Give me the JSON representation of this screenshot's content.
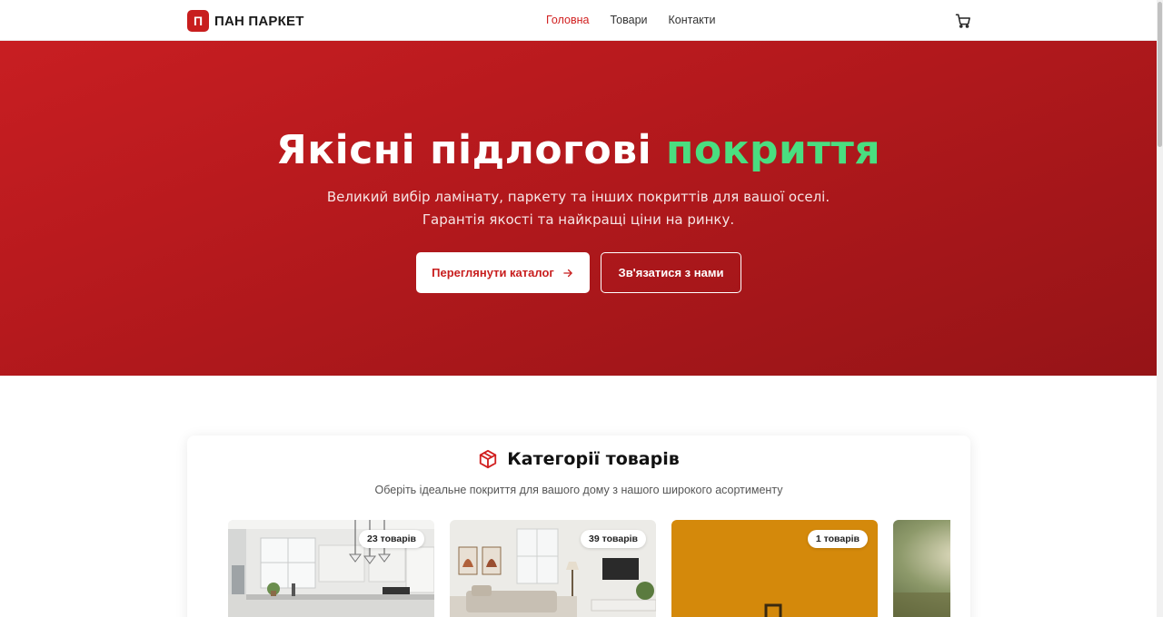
{
  "header": {
    "logo_mark": "П",
    "logo_text": "ПАН ПАРКЕТ",
    "nav": [
      {
        "label": "Головна",
        "active": true
      },
      {
        "label": "Товари",
        "active": false
      },
      {
        "label": "Контакти",
        "active": false
      }
    ],
    "cart_icon": "cart-icon"
  },
  "hero": {
    "title_main": "Якісні підлогові ",
    "title_accent": "покриття",
    "subtitle_line1": "Великий вибір ламінату, паркету та інших покриттів для вашої оселі.",
    "subtitle_line2": "Гарантія якості та найкращі ціни на ринку.",
    "primary_button": "Переглянути каталог",
    "secondary_button": "Зв'язатися з нами"
  },
  "categories": {
    "title": "Категорії товарів",
    "subtitle": "Оберіть ідеальне покриття для вашого дому з нашого широкого асортименту",
    "items": [
      {
        "badge": "23 товарів",
        "image": "kitchen-interior"
      },
      {
        "badge": "39 товарів",
        "image": "living-room-interior"
      },
      {
        "badge": "1 товарів",
        "image": "placeholder-orange"
      },
      {
        "badge": "",
        "image": "outdoor-greenery"
      }
    ]
  },
  "colors": {
    "brand_red": "#c81e1e",
    "accent_green": "#4ade80"
  }
}
